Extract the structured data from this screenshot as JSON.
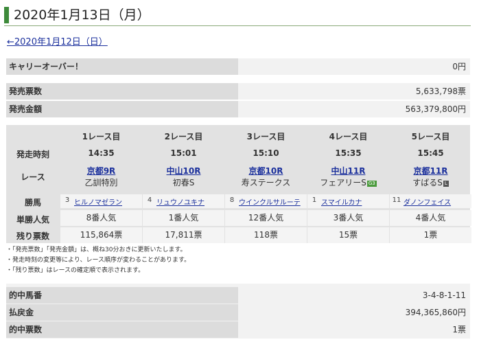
{
  "header": {
    "title": "2020年1月13日（月）",
    "prev_link": "←2020年1月12日（日）"
  },
  "carryover": {
    "label": "キャリーオーバー！",
    "value": "0円"
  },
  "sales": {
    "count_label": "発売票数",
    "count_value": "5,633,798票",
    "amount_label": "発売金額",
    "amount_value": "563,379,800円"
  },
  "race_table": {
    "row_labels": {
      "start_time": "発走時刻",
      "race": "レース",
      "horse": "勝馬",
      "popularity": "単勝人気",
      "remaining": "残り票数"
    },
    "races": [
      {
        "header": "1レース目",
        "time": "14:35",
        "venue_race": "京都9R",
        "name": "乙訓特別",
        "badge": "",
        "badge_color": "",
        "horse_num": "3",
        "horse_name": "ヒルノマゼラン",
        "popularity": "8番人気",
        "remaining": "115,864票"
      },
      {
        "header": "2レース目",
        "time": "15:01",
        "venue_race": "中山10R",
        "name": "初春S",
        "badge": "",
        "badge_color": "",
        "horse_num": "4",
        "horse_name": "リュウノユキナ",
        "popularity": "1番人気",
        "remaining": "17,811票"
      },
      {
        "header": "3レース目",
        "time": "15:10",
        "venue_race": "京都10R",
        "name": "寿ステークス",
        "badge": "",
        "badge_color": "",
        "horse_num": "8",
        "horse_name": "ウインクルサルーテ",
        "popularity": "12番人気",
        "remaining": "118票"
      },
      {
        "header": "4レース目",
        "time": "15:35",
        "venue_race": "中山11R",
        "name": "フェアリーS",
        "badge": "G3",
        "badge_color": "#4a9a3c",
        "horse_num": "1",
        "horse_name": "スマイルカナ",
        "popularity": "3番人気",
        "remaining": "15票"
      },
      {
        "header": "5レース目",
        "time": "15:45",
        "venue_race": "京都11R",
        "name": "すばるS",
        "badge": "L",
        "badge_color": "#555555",
        "horse_num": "11",
        "horse_name": "ダノンフェイス",
        "popularity": "4番人気",
        "remaining": "1票"
      }
    ]
  },
  "notes": [
    "・「発売票数」「発売金額」は、概ね30分おきに更新いたします。",
    "・発走時刻の変更等により、レース順序が変わることがあります。",
    "・「残り票数」はレースの確定順で表示されます。"
  ],
  "results": {
    "winning_label": "的中馬番",
    "winning_value": "3-4-8-1-11",
    "payout_label": "払戻金",
    "payout_value": "394,365,860円",
    "hits_label": "的中票数",
    "hits_value": "1票"
  }
}
